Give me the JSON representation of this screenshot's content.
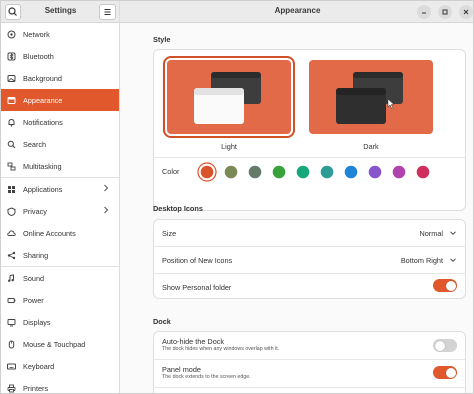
{
  "sidebar": {
    "title": "Settings",
    "items": [
      {
        "label": "Network",
        "icon": "network-icon"
      },
      {
        "label": "Bluetooth",
        "icon": "bluetooth-icon"
      },
      {
        "label": "Background",
        "icon": "background-icon"
      },
      {
        "label": "Appearance",
        "icon": "appearance-icon",
        "active": true
      },
      {
        "label": "Notifications",
        "icon": "bell-icon"
      },
      {
        "label": "Search",
        "icon": "search-icon"
      },
      {
        "label": "Multitasking",
        "icon": "multitasking-icon"
      },
      {
        "label": "Applications",
        "icon": "applications-icon",
        "chevron": true
      },
      {
        "label": "Privacy",
        "icon": "privacy-icon",
        "chevron": true
      },
      {
        "label": "Online Accounts",
        "icon": "online-accounts-icon"
      },
      {
        "label": "Sharing",
        "icon": "sharing-icon"
      },
      {
        "label": "Sound",
        "icon": "sound-icon"
      },
      {
        "label": "Power",
        "icon": "power-icon"
      },
      {
        "label": "Displays",
        "icon": "display-icon"
      },
      {
        "label": "Mouse & Touchpad",
        "icon": "mouse-icon"
      },
      {
        "label": "Keyboard",
        "icon": "keyboard-icon"
      },
      {
        "label": "Printers",
        "icon": "printer-icon"
      }
    ]
  },
  "header": {
    "title": "Appearance"
  },
  "style": {
    "section_title": "Style",
    "light_label": "Light",
    "dark_label": "Dark",
    "selected": "Light",
    "color_label": "Color",
    "colors": [
      "#d9532b",
      "#7b8a55",
      "#667a69",
      "#3aa23a",
      "#17a77a",
      "#2e9c96",
      "#1f83d6",
      "#8855cc",
      "#b043ad",
      "#cf2f5d"
    ],
    "selected_color": "#d9532b"
  },
  "desktop_icons": {
    "section_title": "Desktop Icons",
    "size_label": "Size",
    "size_value": "Normal",
    "position_label": "Position of New Icons",
    "position_value": "Bottom Right",
    "show_personal_label": "Show Personal folder",
    "show_personal_on": true
  },
  "dock": {
    "section_title": "Dock",
    "autohide_label": "Auto-hide the Dock",
    "autohide_sub": "The dock hides when any windows overlap with it.",
    "autohide_on": false,
    "panel_label": "Panel mode",
    "panel_sub": "The dock extends to the screen edge.",
    "panel_on": true
  },
  "colors": {
    "accent": "#e0582c"
  }
}
